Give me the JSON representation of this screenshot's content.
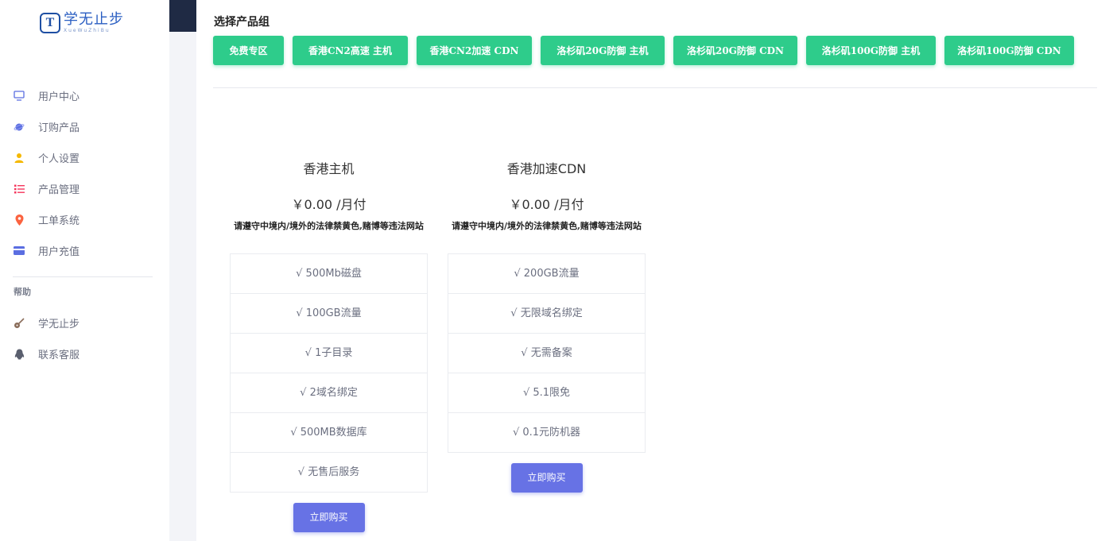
{
  "logo": {
    "mark": "T",
    "title": "学无止步",
    "subtitle": "XueWuZhiBu"
  },
  "sidebar": {
    "items": [
      {
        "label": "用户中心",
        "icon": "monitor-icon"
      },
      {
        "label": "订购产品",
        "icon": "planet-icon"
      },
      {
        "label": "个人设置",
        "icon": "user-icon"
      },
      {
        "label": "产品管理",
        "icon": "list-icon"
      },
      {
        "label": "工单系统",
        "icon": "map-pin-icon"
      },
      {
        "label": "用户充值",
        "icon": "credit-card-icon"
      }
    ],
    "help_title": "帮助",
    "help_items": [
      {
        "label": "学无止步",
        "icon": "guitar-icon"
      },
      {
        "label": "联系客服",
        "icon": "qq-penguin-icon"
      }
    ]
  },
  "main": {
    "group_title": "选择产品组",
    "groups": [
      "免费专区",
      "香港CN2高速 主机",
      "香港CN2加速 CDN",
      "洛杉矶20G防御 主机",
      "洛杉矶20G防御 CDN",
      "洛杉矶100G防御 主机",
      "洛杉矶100G防御 CDN"
    ],
    "products": [
      {
        "title": "香港主机",
        "price": "￥0.00 /月付",
        "notice": "请遵守中境内/境外的法律禁黄色,赌博等违法网站",
        "features": [
          "√ 500Mb磁盘",
          "√ 100GB流量",
          "√ 1子目录",
          "√ 2域名绑定",
          "√ 500MB数据库",
          "√ 无售后服务"
        ],
        "buy_label": "立即购买"
      },
      {
        "title": "香港加速CDN",
        "price": "￥0.00 /月付",
        "notice": "请遵守中境内/境外的法律禁黄色,赌博等违法网站",
        "features": [
          "√ 200GB流量",
          "√ 无限域名绑定",
          "√ 无需备案",
          "√ 5.1限免",
          "√ 0.1元防机器"
        ],
        "buy_label": "立即购买"
      }
    ]
  },
  "colors": {
    "group_button": "#2ecc8b",
    "buy_button": "#6772e5",
    "logo": "#2a5ec2"
  }
}
